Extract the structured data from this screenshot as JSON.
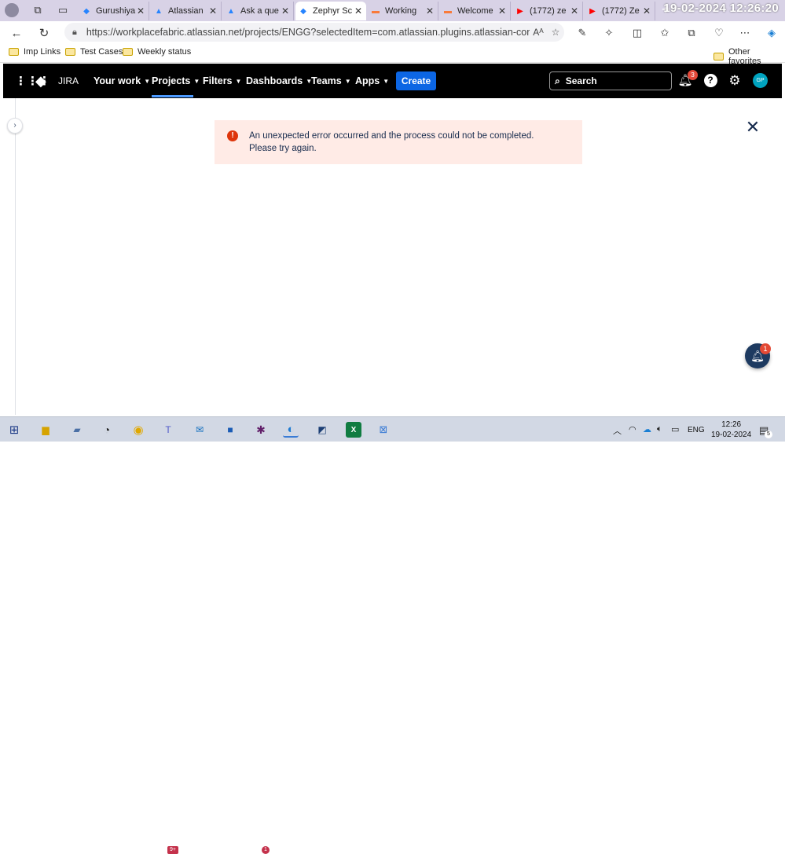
{
  "browser": {
    "tabs": [
      {
        "label": "Gurushiya",
        "icon": "jira-icon",
        "color": "#2684ff"
      },
      {
        "label": "Atlassian",
        "icon": "atlassian-icon",
        "color": "#2684ff"
      },
      {
        "label": "Ask a que",
        "icon": "atlassian-icon",
        "color": "#2684ff"
      },
      {
        "label": "Zephyr Sc",
        "icon": "jira-icon",
        "color": "#2684ff",
        "active": true
      },
      {
        "label": "Working",
        "icon": "zephyr-icon",
        "color": "#f97a3a"
      },
      {
        "label": "Welcome",
        "icon": "zephyr-icon",
        "color": "#f97a3a"
      },
      {
        "label": "(1772) ze",
        "icon": "youtube-icon",
        "color": "#ff0000"
      },
      {
        "label": "(1772) Ze",
        "icon": "youtube-icon",
        "color": "#ff0000"
      }
    ],
    "clock_overlay": "19-02-2024  12:26:20",
    "url": "https://workplacefabric.atlassian.net/projects/ENGG?selectedItem=com.atlassian.plugins.atlassian-connect-pl...",
    "read_aloud": "Aᴬ",
    "bookmarks": [
      "Imp Links",
      "Test Cases",
      "Weekly status"
    ],
    "other_favorites": "Other favorites"
  },
  "jira": {
    "logo_text": "JIRA",
    "nav": [
      "Your work",
      "Projects",
      "Filters",
      "Dashboards",
      "Teams",
      "Apps"
    ],
    "create_label": "Create",
    "search_label": "Search",
    "notification_count": "3",
    "avatar_initials": "GP",
    "error_message": "An unexpected error occurred and the process could not be completed. Please try again.",
    "chat_badge": "1"
  },
  "taskbar": {
    "teams_badge": "9+",
    "slack_badge": "1",
    "lang": "ENG",
    "time": "12:26",
    "date": "19-02-2024",
    "notif_count": "5"
  }
}
